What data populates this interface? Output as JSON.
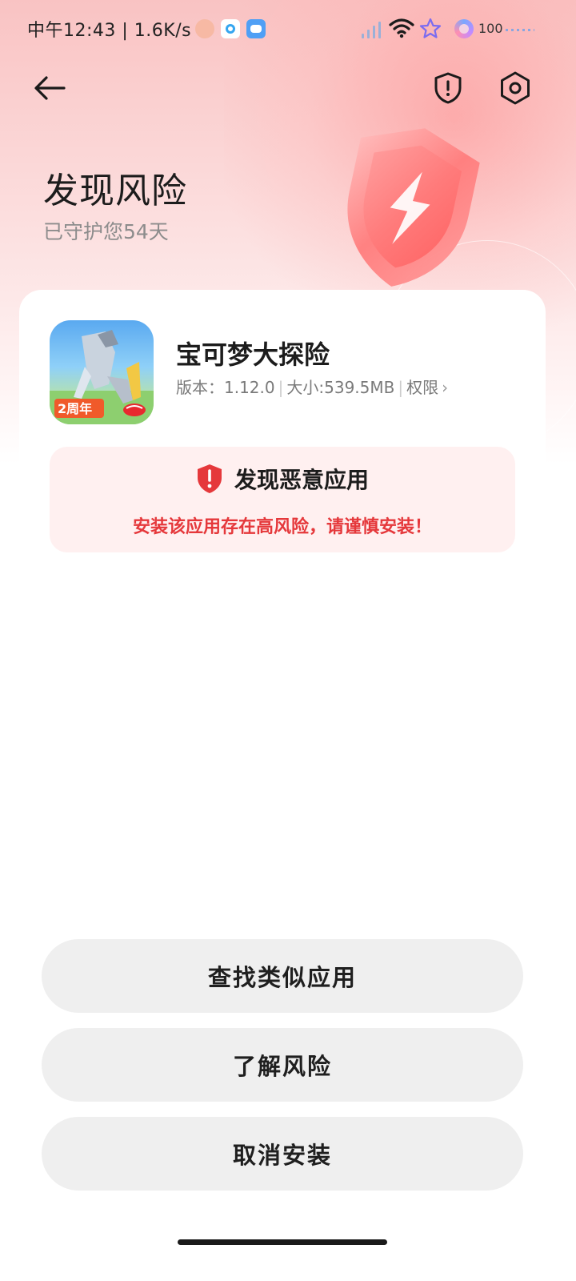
{
  "status_bar": {
    "time": "中午12:43 | 1.6K/s",
    "battery": "100"
  },
  "nav": {
    "back_icon": "arrow-left-icon",
    "shield_icon": "shield-exclamation-icon",
    "settings_icon": "gear-icon"
  },
  "header": {
    "title": "发现风险",
    "subtitle": "已守护您54天"
  },
  "app": {
    "name": "宝可梦大探险",
    "version_label": "版本：",
    "version": "1.12.0",
    "size_label": "大小:",
    "size": "539.5MB",
    "permission_label": "权限",
    "icon_badge": "2周年"
  },
  "warning": {
    "title": "发现恶意应用",
    "description": "安装该应用存在高风险，请谨慎安装！",
    "icon": "red-shield-exclamation-icon"
  },
  "actions": {
    "find_similar": "查找类似应用",
    "learn_risk": "了解风险",
    "cancel_install": "取消安装"
  },
  "colors": {
    "accent_red": "#e5383b",
    "warning_bg": "#fff0f0",
    "button_bg": "#efefef"
  }
}
